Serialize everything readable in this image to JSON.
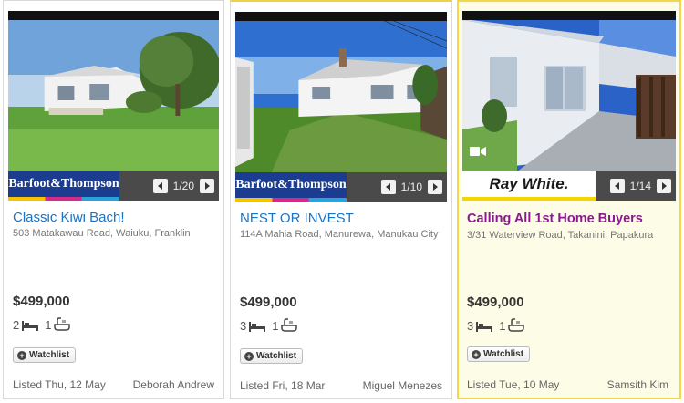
{
  "listings": [
    {
      "agency": "Barfoot&Thompson",
      "photo_counter": "1/20",
      "title": "Classic Kiwi Bach!",
      "address": "503 Matakawau Road, Waiuku, Franklin",
      "price": "$499,000",
      "bedrooms": "2",
      "bathrooms": "1",
      "watchlist_label": "Watchlist",
      "listed": "Listed Thu, 12 May",
      "agent": "Deborah Andrew"
    },
    {
      "agency": "Barfoot&Thompson",
      "photo_counter": "1/10",
      "title": "NEST OR INVEST",
      "address": "114A Mahia Road, Manurewa, Manukau City",
      "price": "$499,000",
      "bedrooms": "3",
      "bathrooms": "1",
      "watchlist_label": "Watchlist",
      "listed": "Listed Fri, 18 Mar",
      "agent": "Miguel Menezes"
    },
    {
      "agency": "Ray White.",
      "photo_counter": "1/14",
      "title": "Calling All 1st Home Buyers",
      "address": "3/31 Waterview Road, Takanini, Papakura",
      "price": "$499,000",
      "bedrooms": "3",
      "bathrooms": "1",
      "watchlist_label": "Watchlist",
      "listed": "Listed Tue, 10 May",
      "agent": "Samsith Kim"
    }
  ],
  "icons": {
    "prev": "chevron-left-icon",
    "next": "chevron-right-icon",
    "bed": "bed-icon",
    "bath": "bath-icon",
    "video": "video-camera-icon",
    "watch": "plus-circle-icon"
  },
  "colors": {
    "link_blue": "#1a73c6",
    "featured_title": "#8a1b8f",
    "featured_bg": "#fdfce6",
    "featured_border": "#f2d84a",
    "barfoot_blue": "#1c3d8f"
  }
}
